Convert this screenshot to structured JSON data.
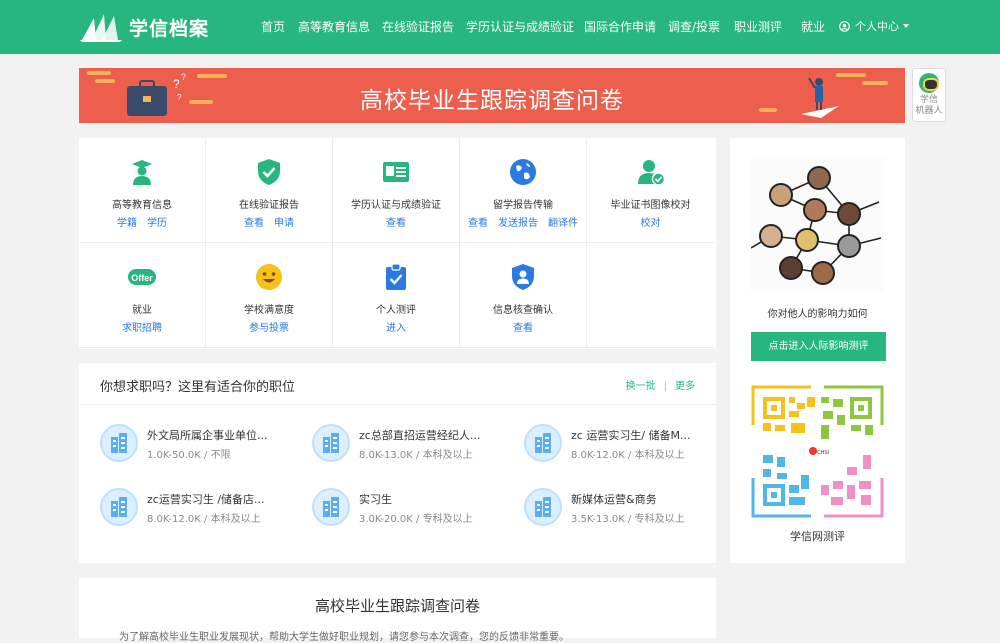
{
  "header": {
    "logo_text": "学信档案",
    "nav": [
      "首页",
      "高等教育信息",
      "在线验证报告",
      "学历认证与成绩验证",
      "国际合作申请",
      "调查/投票",
      "职业测评",
      "就业"
    ],
    "user_menu": "个人中心"
  },
  "banner": {
    "title": "高校毕业生跟踪调查问卷",
    "q_marks": [
      "?",
      "?",
      "?"
    ]
  },
  "robot": {
    "line1": "学信",
    "line2": "机器人"
  },
  "services": [
    {
      "icon": "graduate-icon",
      "name": "高等教育信息",
      "links": [
        "学籍",
        "学历"
      ]
    },
    {
      "icon": "shield-check-icon",
      "name": "在线验证报告",
      "links": [
        "查看",
        "申请"
      ]
    },
    {
      "icon": "id-card-icon",
      "name": "学历认证与成绩验证",
      "links": [
        "查看"
      ]
    },
    {
      "icon": "globe-icon",
      "name": "留学报告传输",
      "links": [
        "查看",
        "发送报告",
        "翻译件"
      ]
    },
    {
      "icon": "user-check-icon",
      "name": "毕业证书图像校对",
      "links": [
        "校对"
      ]
    },
    {
      "icon": "offer-icon",
      "name": "就业",
      "links": [
        "求职招聘"
      ],
      "badge": "Offer"
    },
    {
      "icon": "smile-icon",
      "name": "学校满意度",
      "links": [
        "参与投票"
      ]
    },
    {
      "icon": "clipboard-icon",
      "name": "个人测评",
      "links": [
        "进入"
      ]
    },
    {
      "icon": "user-shield-icon",
      "name": "信息核查确认",
      "links": [
        "查看"
      ]
    }
  ],
  "jobs": {
    "heading": "你想求职吗？这里有适合你的职位",
    "refresh": "换一批",
    "more": "更多",
    "items": [
      {
        "title": "外文局所属企事业单位...",
        "meta": "1.0K-50.0K / 不限"
      },
      {
        "title": "zc总部直招运营经纪人...",
        "meta": "8.0K-13.0K / 本科及以上"
      },
      {
        "title": "zc 运营实习生/ 储备M...",
        "meta": "8.0K-12.0K / 本科及以上"
      },
      {
        "title": "zc运营实习生 /储备店...",
        "meta": "8.0K-12.0K / 本科及以上"
      },
      {
        "title": "实习生",
        "meta": "3.0K-20.0K / 专科及以上"
      },
      {
        "title": "新媒体运营&商务",
        "meta": "3.5K-13.0K / 专科及以上"
      }
    ]
  },
  "sidebar": {
    "photo_caption": "你对他人的影响力如何",
    "button": "点击进入人际影响测评",
    "qr_caption": "学信网测评",
    "qr_badge": "CHSI"
  },
  "survey": {
    "title": "高校毕业生跟踪调查问卷",
    "desc": "为了解高校毕业生职业发展现状，帮助大学生做好职业规划，请您参与本次调查，您的反馈非常重要。"
  },
  "colors": {
    "brand": "#27b77e",
    "banner": "#ee5e4d",
    "link": "#2a7ae2"
  }
}
